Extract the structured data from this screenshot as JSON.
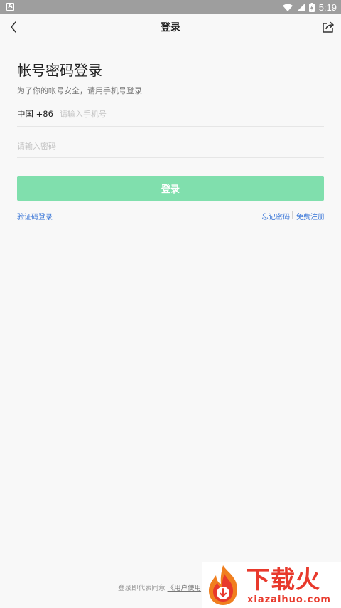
{
  "status_bar": {
    "time": "5:19",
    "left_icon": "A"
  },
  "app_bar": {
    "title": "登录",
    "back_icon": "chevron-left-icon",
    "share_icon": "share-icon"
  },
  "login": {
    "heading": "帐号密码登录",
    "subheading": "为了你的帐号安全，请用手机号登录",
    "country_code": "中国 +86",
    "phone_placeholder": "请输入手机号",
    "password_placeholder": "请输入密码",
    "login_button": "登录",
    "sms_login": "验证码登录",
    "forgot_password": "忘记密码",
    "register": "免费注册"
  },
  "footer": {
    "agree_text": "登录即代表同意",
    "terms_link": "《用户使用"
  },
  "watermark": {
    "title": "下载火",
    "url": "xiazaihuo.com"
  },
  "colors": {
    "accent_green": "#80dfad",
    "link_blue": "#2f6fd6",
    "watermark_red": "#e8392c"
  }
}
